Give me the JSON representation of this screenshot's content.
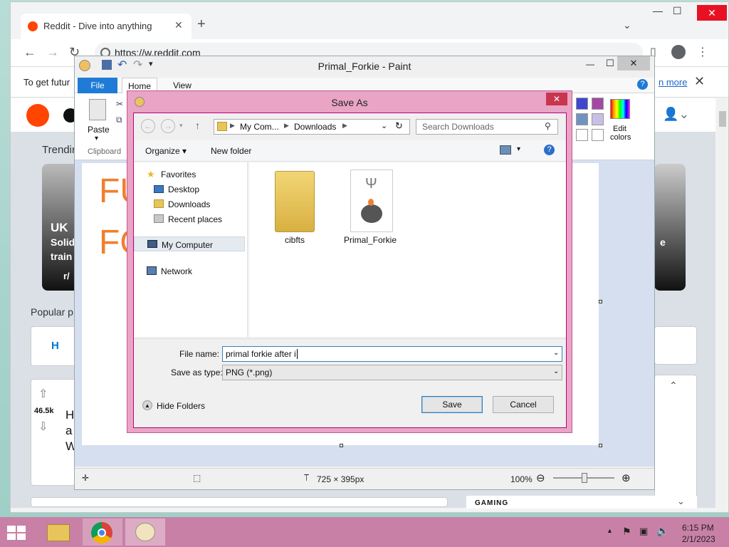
{
  "browser": {
    "tab_title": "Reddit - Dive into anything",
    "url": "https://w.reddit.com",
    "banner_text": "To get futur",
    "banner_more": "n more"
  },
  "reddit": {
    "trending_label": "Trendin",
    "card_left_title": "UK",
    "card_left_line1": "Solid",
    "card_left_line2": "train",
    "card_left_sub": "r/",
    "card_right_char": "e",
    "popular_label": "Popular p",
    "popular_tab": "H",
    "vote_count": "46.5k",
    "post_line1": "H",
    "post_line2": "a",
    "post_line3": "W",
    "gaming_label": "GAMING"
  },
  "paint": {
    "title": "Primal_Forkie - Paint",
    "tab_file": "File",
    "tab_home": "Home",
    "tab_view": "View",
    "paste_label": "Paste",
    "clipboard_label": "Clipboard",
    "edit_colors_line1": "Edit",
    "edit_colors_line2": "colors",
    "canvas_text_line1": "FU",
    "canvas_text_line2": "FO",
    "canvas_size": "725 × 395px",
    "zoom": "100%"
  },
  "dialog": {
    "title": "Save As",
    "breadcrumb_1": "My Com...",
    "breadcrumb_2": "Downloads",
    "search_placeholder": "Search Downloads",
    "organize_label": "Organize",
    "new_folder_label": "New folder",
    "nav_items": {
      "favorites": "Favorites",
      "desktop": "Desktop",
      "downloads": "Downloads",
      "recent": "Recent places",
      "computer": "My Computer",
      "network": "Network"
    },
    "files": [
      {
        "name": "cibfts",
        "type": "folder"
      },
      {
        "name": "Primal_Forkie",
        "type": "image"
      }
    ],
    "file_name_label": "File name:",
    "file_name_value": "primal forkie after i",
    "save_type_label": "Save as type:",
    "save_type_value": "PNG (*.png)",
    "hide_folders_label": "Hide Folders",
    "save_button": "Save",
    "cancel_button": "Cancel"
  },
  "taskbar": {
    "time": "6:15 PM",
    "date": "2/1/2023"
  },
  "colors": {
    "dialog_frame": "#e9a4c6",
    "taskbar": "#c980a6",
    "paint_file_tab": "#1e7bd6",
    "canvas_text": "#f07f2e",
    "reddit_orange": "#ff4500"
  }
}
